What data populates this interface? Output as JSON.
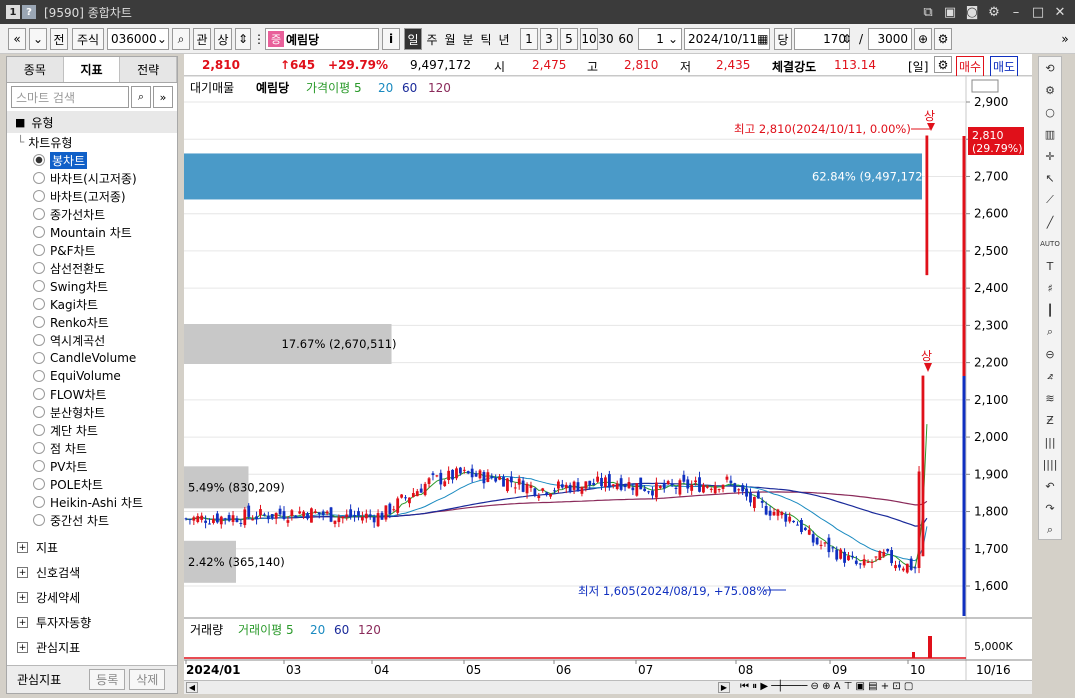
{
  "window": {
    "num1": "1",
    "num2": "?",
    "title": "[9590] 종합차트"
  },
  "toolbar": {
    "nav_prev": "«",
    "nav_down": "»",
    "jeon": "전",
    "market": "주식",
    "code": "036000",
    "kwan": "관",
    "sang": "상",
    "name": "예림당",
    "badge": "증",
    "info": "i",
    "periods": [
      "일",
      "주",
      "월",
      "분",
      "틱",
      "년"
    ],
    "active_period": "일",
    "minutes": [
      "1",
      "3",
      "5",
      "10",
      "30",
      "60"
    ],
    "multiplier": "1",
    "date": "2024/10/11",
    "dang": "당",
    "count": "170",
    "slash": "/",
    "total": "3000"
  },
  "quote": {
    "price": "2,810",
    "change": "↑645",
    "change_pct": "+29.79%",
    "volume": "9,497,172",
    "open_label": "시",
    "open": "2,475",
    "high_label": "고",
    "high": "2,810",
    "low_label": "저",
    "low": "2,435",
    "strength_label": "체결강도",
    "strength": "113.14",
    "period_tag": "[일]",
    "buy": "매수",
    "sell": "매도"
  },
  "left": {
    "tabs": [
      "종목",
      "지표",
      "전략"
    ],
    "active_tab": "지표",
    "search_placeholder": "스마트 검색",
    "type_header": "유형",
    "chart_type_header": "차트유형",
    "chart_types": [
      "봉차트",
      "바차트(시고저종)",
      "바차트(고저종)",
      "종가선차트",
      "Mountain 차트",
      "P&F차트",
      "삼선전환도",
      "Swing차트",
      "Kagi차트",
      "Renko차트",
      "역시계곡선",
      "CandleVolume",
      "EquiVolume",
      "FLOW차트",
      "분산형차트",
      "계단 차트",
      "점 차트",
      "PV차트",
      "POLE차트",
      "Heikin-Ashi 차트",
      "중간선 차트"
    ],
    "selected_type": "봉차트",
    "groups": [
      "지표",
      "신호검색",
      "강세약세",
      "투자자동향",
      "관심지표"
    ],
    "bottom_label": "관심지표",
    "register": "등록",
    "delete": "삭제"
  },
  "chart": {
    "legend": {
      "waiting": "대기매물",
      "name": "예림당",
      "ma_label": "가격이평 5",
      "ma20": "20",
      "ma60": "60",
      "ma120": "120"
    },
    "y_ticks": [
      "2,900",
      "2,800",
      "2,700",
      "2,600",
      "2,500",
      "2,400",
      "2,300",
      "2,200",
      "2,100",
      "2,000",
      "1,900",
      "1,800",
      "1,700",
      "1,600"
    ],
    "price_tag": "2,810",
    "price_tag_pct": "(29.79%)",
    "high_note": "최고 2,810(2024/10/11, 0.00%)",
    "low_note": "최저 1,605(2024/08/19, +75.08%)",
    "sang_labels": [
      "상",
      "상"
    ],
    "supply_bars": [
      {
        "label": "62.84% (9,497,172)",
        "pct": 62.84
      },
      {
        "label": "17.67% (2,670,511)",
        "pct": 17.67
      },
      {
        "label": "5.49% (830,209)",
        "pct": 5.49
      },
      {
        "label": "2.42% (365,140)",
        "pct": 2.42
      }
    ],
    "vol_legend": {
      "name": "거래량",
      "ma_label": "거래이평 5",
      "ma20": "20",
      "ma60": "60",
      "ma120": "120"
    },
    "vol_tick": "5,000K",
    "x_labels": [
      "2024/01",
      "03",
      "04",
      "05",
      "06",
      "07",
      "08",
      "09",
      "10"
    ],
    "x_end": "10/16",
    "colors": {
      "up": "#e0101a",
      "down": "#1030c0",
      "supply_blue": "#4a9ac8",
      "supply_gray": "#c8c8c8",
      "ma5": "#2a9a2a",
      "ma20": "#1a8ac0",
      "ma60": "#1a2a9a",
      "ma120": "#8a2a5a"
    }
  }
}
